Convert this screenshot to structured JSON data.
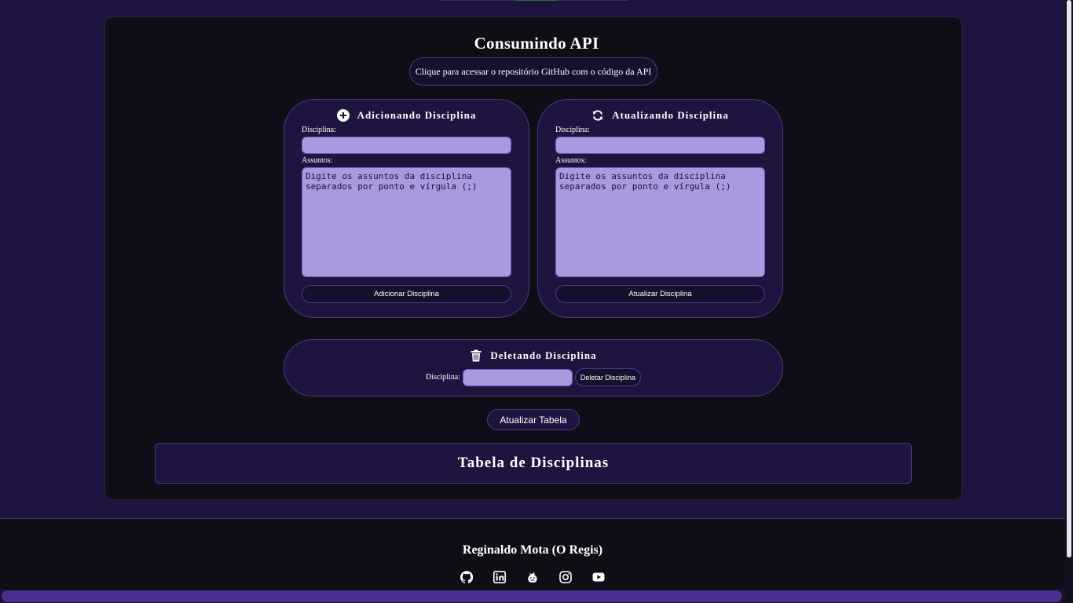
{
  "header": {
    "title": "Consumindo API",
    "repo_link": "Clique para acessar o repositório GitHub com o código da API"
  },
  "add_panel": {
    "title": "Adicionando Disciplina",
    "icon": "plus-circle-icon",
    "discipline_label": "Disciplina:",
    "discipline_value": "",
    "subjects_label": "Assuntos:",
    "subjects_placeholder": "Digite os assuntos da disciplina separados por ponto e vírgula (;)",
    "button": "Adicionar Disciplina"
  },
  "update_panel": {
    "title": "Atualizando Disciplina",
    "icon": "refresh-icon",
    "discipline_label": "Disciplina:",
    "discipline_value": "",
    "subjects_label": "Assuntos:",
    "subjects_placeholder": "Digite os assuntos da disciplina separados por ponto e vírgula (;)",
    "button": "Atualizar Disciplina"
  },
  "delete_panel": {
    "title": "Deletando Disciplina",
    "icon": "trash-icon",
    "discipline_label": "Disciplina:",
    "discipline_value": "",
    "button": "Deletar Disciplina"
  },
  "refresh_table_button": "Atualizar Tabela",
  "table": {
    "title": "Tabela de Disciplinas"
  },
  "footer": {
    "name": "Reginaldo Mota (O Regis)",
    "socials": [
      "github-icon",
      "linkedin-icon",
      "beecrowd-icon",
      "instagram-icon",
      "youtube-icon"
    ]
  },
  "colors": {
    "background": "#1f1440",
    "card": "#0e0e16",
    "input": "#a99ae0",
    "border": "#4a3a80",
    "scrollbar": "#4b2e8e"
  }
}
